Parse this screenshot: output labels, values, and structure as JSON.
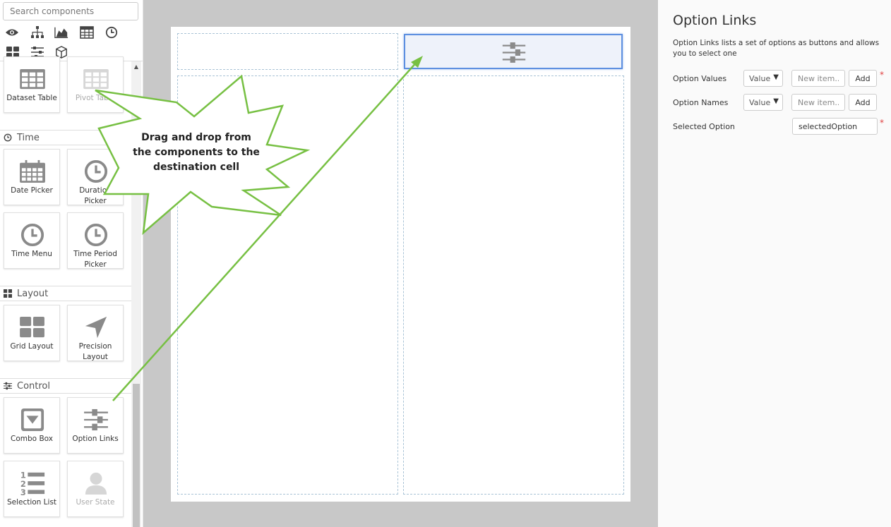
{
  "search": {
    "placeholder": "Search components"
  },
  "category_icons": [
    "eye-icon",
    "hierarchy-icon",
    "area-chart-icon",
    "table-icon",
    "clock-icon",
    "grid-icon",
    "sliders-icon",
    "cube-icon"
  ],
  "palette": {
    "top_tiles": [
      {
        "label": "Dataset Table",
        "icon": "table-grid-icon",
        "enabled": true
      },
      {
        "label": "Pivot Table",
        "icon": "table-grid-icon",
        "enabled": false
      }
    ],
    "sections": [
      {
        "title": "Time",
        "icon": "clock-icon",
        "tiles": [
          {
            "label": "Date Picker",
            "icon": "calendar-icon"
          },
          {
            "label": "Duration Picker",
            "icon": "clock-icon"
          },
          {
            "label": "Time Menu",
            "icon": "clock-icon"
          },
          {
            "label": "Time Period Picker",
            "icon": "clock-icon"
          }
        ]
      },
      {
        "title": "Layout",
        "icon": "grid-icon",
        "tiles": [
          {
            "label": "Grid Layout",
            "icon": "grid-icon"
          },
          {
            "label": "Precision Layout",
            "icon": "pointer-icon"
          }
        ]
      },
      {
        "title": "Control",
        "icon": "sliders-icon",
        "tiles": [
          {
            "label": "Combo Box",
            "icon": "combo-box-icon"
          },
          {
            "label": "Option Links",
            "icon": "sliders-icon"
          },
          {
            "label": "Selection List",
            "icon": "numbered-list-icon"
          },
          {
            "label": "User State",
            "icon": "user-icon",
            "enabled": false
          }
        ]
      }
    ]
  },
  "callout": {
    "text_line1": "Drag and drop from",
    "text_line2": "the components to the",
    "text_line3": "destination cell"
  },
  "properties": {
    "title": "Option Links",
    "description": "Option Links lists a set of options as buttons and allows you to select one",
    "option_values": {
      "label": "Option Values",
      "select": "Value",
      "placeholder": "New item...",
      "button": "Add",
      "required": "*"
    },
    "option_names": {
      "label": "Option Names",
      "select": "Value",
      "placeholder": "New item...",
      "button": "Add"
    },
    "selected_option": {
      "label": "Selected Option",
      "value": "selectedOption",
      "required": "*"
    }
  },
  "colors": {
    "accent_green": "#77c043",
    "selection_blue": "#5d8fe0",
    "icon_gray": "#8a8a8a"
  }
}
